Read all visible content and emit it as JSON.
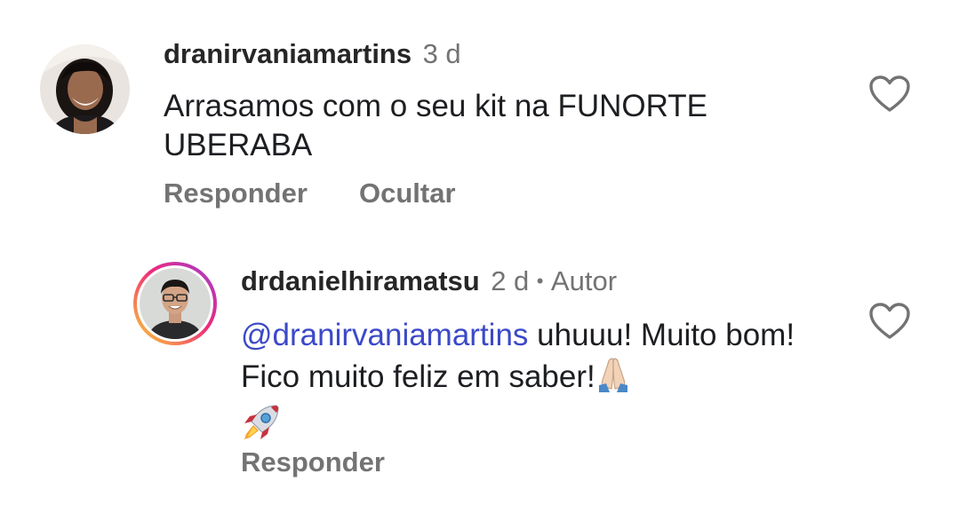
{
  "comments": [
    {
      "username": "dranirvaniamartins",
      "time": "3 d",
      "text": "Arrasamos com o seu kit na FUNORTE UBERABA",
      "actions": {
        "reply_label": "Responder",
        "hide_label": "Ocultar"
      },
      "like_icon": "heart-outline-icon"
    }
  ],
  "replies": [
    {
      "username": "drdanielhiramatsu",
      "time": "2 d",
      "separator": "•",
      "author_badge": "Autor",
      "mention": "@dranirvaniamartins",
      "text": " uhuuu! Muito bom! Fico muito feliz em saber!",
      "emojis": [
        "folded-hands-emoji",
        "rocket-emoji"
      ],
      "actions": {
        "reply_label": "Responder"
      },
      "like_icon": "heart-outline-icon",
      "story_ring": true
    }
  ],
  "colors": {
    "username": "#262626",
    "meta": "#737373",
    "mention": "#3b49c7",
    "ring_start": "#f9ce34",
    "ring_mid": "#ee2a7b",
    "ring_end": "#6228d7"
  }
}
